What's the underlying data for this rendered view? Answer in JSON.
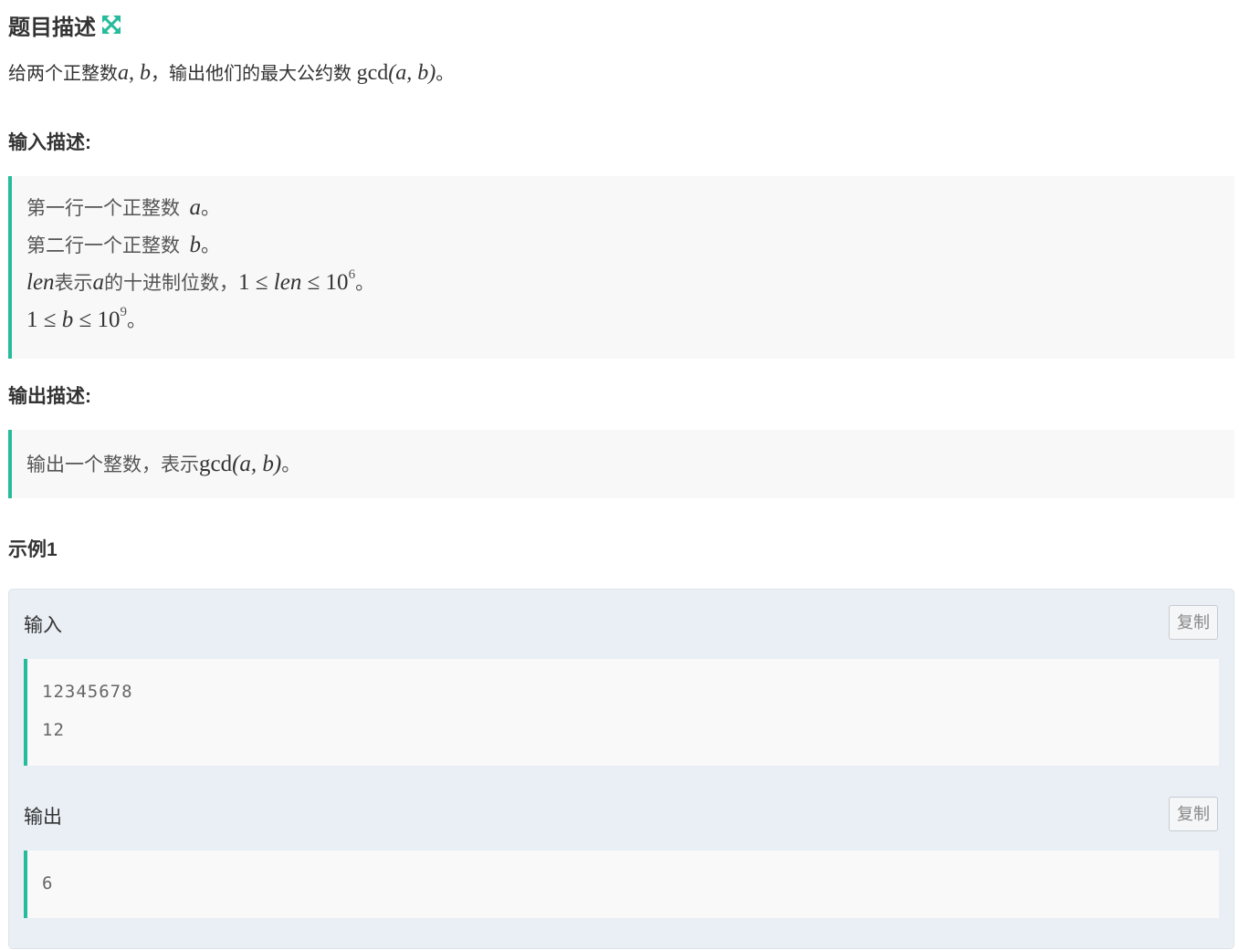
{
  "problem": {
    "title": "题目描述",
    "expand_icon": "expand-arrows-icon",
    "accent_color": "#25bb9b",
    "description": {
      "prefix": "给两个正整数",
      "vars": "a, b",
      "mid": "，输出他们的最大公约数",
      "gcd": "gcd",
      "args": "(a, b)",
      "suffix": "。"
    }
  },
  "input_section": {
    "heading": "输入描述:",
    "lines": [
      {
        "text": "第一行一个正整数",
        "math": "a",
        "end": "。"
      },
      {
        "text": "第二行一个正整数",
        "math": "b",
        "end": "。"
      },
      {
        "math_start": "len",
        "text": "表示",
        "math_a": "a",
        "text2": "的十进制位数，",
        "range": "1 ≤ ",
        "math_len": "len",
        "range2": " ≤ 10",
        "exp": "6",
        "end": "。"
      },
      {
        "range": "1 ≤ ",
        "math_b": "b",
        "range2": " ≤ 10",
        "exp": "9",
        "end": "。"
      }
    ]
  },
  "output_section": {
    "heading": "输出描述:",
    "line": {
      "text": "输出一个整数，表示",
      "gcd": "gcd",
      "args": "(a, b)",
      "end": "。"
    }
  },
  "example": {
    "heading": "示例1",
    "input_label": "输入",
    "output_label": "输出",
    "copy_label": "复制",
    "input_lines": [
      "12345678",
      "12"
    ],
    "output_lines": [
      "6"
    ]
  }
}
